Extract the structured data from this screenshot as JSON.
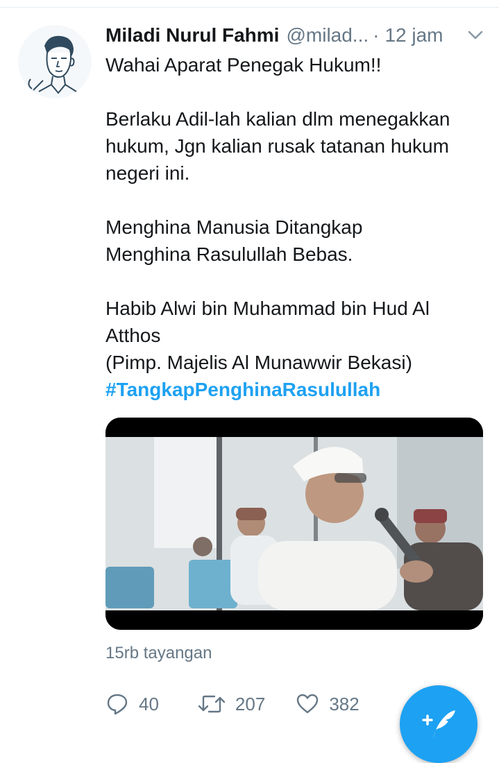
{
  "tweet": {
    "display_name": "Miladi Nurul Fahmi",
    "handle": "@milad...",
    "separator": "·",
    "time": "12 jam",
    "text": "Wahai Aparat Penegak Hukum!!\n\nBerlaku Adil-lah kalian dlm menegakkan hukum, Jgn kalian rusak tatanan hukum negeri ini.\n\nMenghina Manusia Ditangkap\nMenghina Rasulullah Bebas.\n\nHabib Alwi bin Muhammad bin Hud Al Atthos\n(Pimp. Majelis Al Munawwir Bekasi)",
    "hashtag": "#TangkapPenghinaRasulullah",
    "views": "15rb tayangan"
  },
  "actions": {
    "replies": "40",
    "retweets": "207",
    "likes": "382"
  },
  "icons": {
    "avatar": "avatar-illustration",
    "caret": "chevron-down-icon",
    "reply": "reply-icon",
    "retweet": "retweet-icon",
    "like": "heart-icon",
    "compose": "compose-tweet-icon"
  },
  "colors": {
    "accent": "#1da1f2",
    "secondary_text": "#657786",
    "primary_text": "#14171a"
  }
}
